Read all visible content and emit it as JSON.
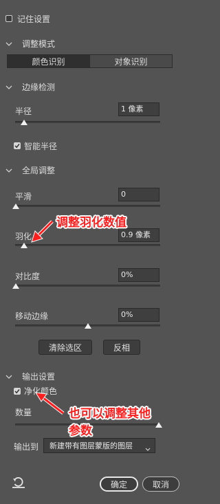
{
  "remember_settings": {
    "label": "记住设置",
    "checked": false
  },
  "adjust_mode": {
    "title": "调整模式",
    "tabs": [
      {
        "label": "颜色识别",
        "active": true
      },
      {
        "label": "对象识别",
        "active": false
      }
    ]
  },
  "edge_detection": {
    "title": "边缘检测",
    "radius": {
      "label": "半径",
      "value": "1 像素",
      "slider_fraction": 0.06
    },
    "smart_radius": {
      "label": "智能半径",
      "checked": true
    }
  },
  "global_adjust": {
    "title": "全局调整",
    "smooth": {
      "label": "平滑",
      "value": "0",
      "slider_fraction": 0.0
    },
    "feather": {
      "label": "羽化",
      "value": "0.9 像素",
      "slider_fraction": 0.06
    },
    "contrast": {
      "label": "对比度",
      "value": "0%",
      "slider_fraction": 0.0
    },
    "shift_edge": {
      "label": "移动边缘",
      "value": "0%",
      "slider_fraction": 0.5
    },
    "clear_selection_label": "清除选区",
    "invert_label": "反相"
  },
  "output_settings": {
    "title": "输出设置",
    "decontaminate": {
      "label": "净化颜色",
      "checked": true
    },
    "amount": {
      "label": "数量",
      "slider_fraction": 1.0
    },
    "output_to": {
      "label": "输出到",
      "value": "新建带有图层蒙版的图层"
    }
  },
  "footer": {
    "reset_icon": "reset-icon",
    "ok_label": "确定",
    "cancel_label": "取消"
  },
  "annotations": {
    "feather_note": "调整羽化数值",
    "other_note_line1": "也可以调整其他",
    "other_note_line2": "参数"
  },
  "colors": {
    "panel_bg": "#535353",
    "annotation_red": "#ff1e1e"
  }
}
